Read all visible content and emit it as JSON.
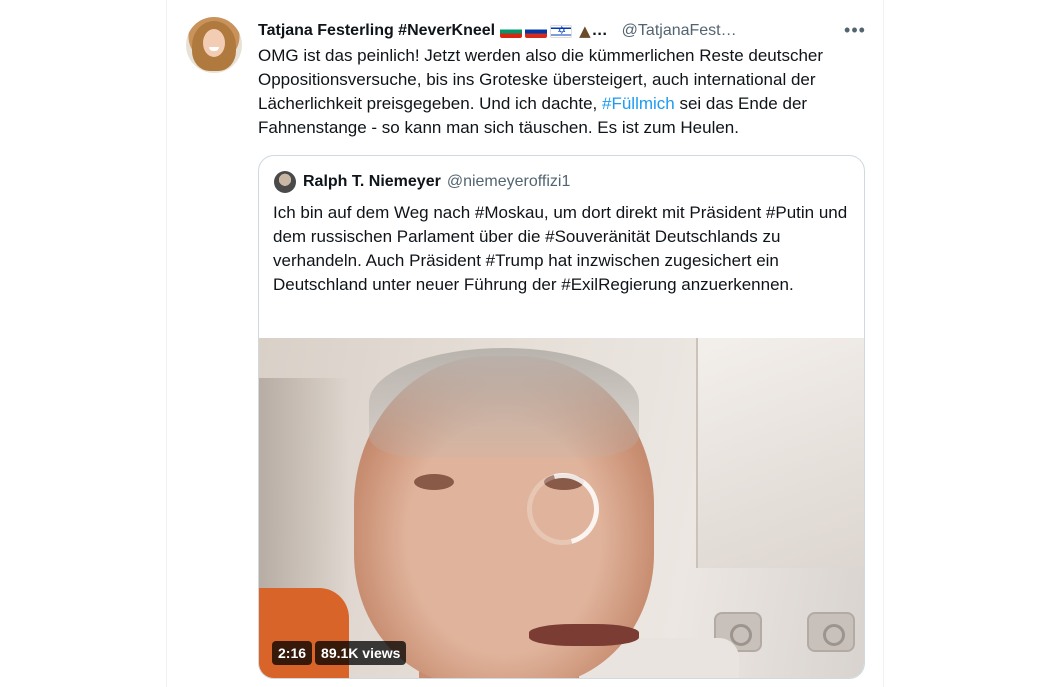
{
  "tweet": {
    "author_name": "Tatjana Festerling #NeverKneel",
    "author_truncation": "…",
    "author_handle": "@TatjanaFest…",
    "more_glyph": "•••",
    "text_before_hashtag": "OMG ist das peinlich! Jetzt werden also die kümmerlichen Reste deutscher Oppositionsversuche, bis ins Groteske übersteigert, auch international der Lächerlichkeit preisgegeben. Und ich dachte, ",
    "hashtag": "#Füllmich",
    "text_after_hashtag": " sei das Ende der Fahnenstange - so kann man sich täuschen. Es ist zum Heulen.",
    "name_emoji_icons": [
      "flag-bulgaria-icon",
      "flag-russia-icon",
      "flag-israel-icon",
      "volcano-icon"
    ]
  },
  "quoted_tweet": {
    "author_name": "Ralph T. Niemeyer",
    "author_handle": "@niemeyeroffizi1",
    "text": "Ich bin auf dem Weg nach #Moskau, um dort direkt mit Präsident #Putin und dem russischen Parlament über die #Souveränität Deutschlands zu verhandeln. Auch Präsident #Trump hat inzwischen zugesichert ein Deutschland unter neuer Führung der #ExilRegierung anzuerkennen.",
    "video": {
      "duration": "2:16",
      "views": "89.1K views"
    }
  },
  "colors": {
    "link": "#1d9bf0",
    "text_primary": "#0f1419",
    "text_secondary": "#536471",
    "border": "#cfd9de"
  }
}
